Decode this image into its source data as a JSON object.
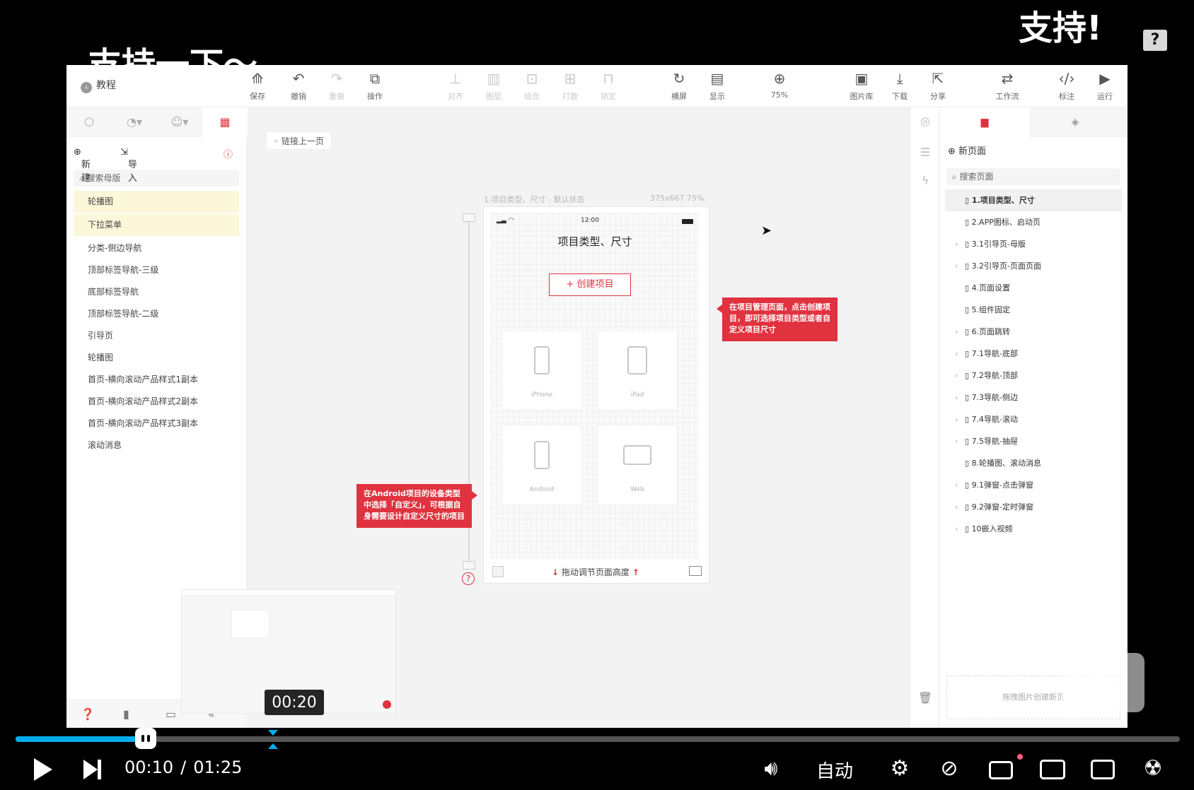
{
  "danmaku": {
    "left": "支持一下～",
    "right": "支持!"
  },
  "help_badge": "?",
  "app": {
    "tutorial_label": "教程",
    "toolbar": [
      {
        "icon": "⟰",
        "label": "保存",
        "dim": false
      },
      {
        "icon": "↶",
        "label": "撤销",
        "dim": false
      },
      {
        "icon": "↷",
        "label": "重做",
        "dim": true
      },
      {
        "icon": "⧉",
        "label": "操作",
        "dim": false
      },
      {
        "icon": "⊥",
        "label": "对齐",
        "dim": true
      },
      {
        "icon": "▥",
        "label": "图层",
        "dim": true
      },
      {
        "icon": "⊡",
        "label": "组合",
        "dim": true
      },
      {
        "icon": "⊞",
        "label": "打散",
        "dim": true
      },
      {
        "icon": "⊓",
        "label": "锁定",
        "dim": true
      },
      {
        "icon": "↻",
        "label": "横屏",
        "dim": false
      },
      {
        "icon": "▤",
        "label": "显示",
        "dim": false
      },
      {
        "icon": "⊕",
        "label": "75%",
        "dim": false
      },
      {
        "icon": "▣",
        "label": "图片库",
        "dim": false
      },
      {
        "icon": "⤓",
        "label": "下载",
        "dim": false
      },
      {
        "icon": "⇱",
        "label": "分享",
        "dim": false
      },
      {
        "icon": "⇄",
        "label": "工作流",
        "dim": false
      },
      {
        "icon": "‹/›",
        "label": "标注",
        "dim": false
      },
      {
        "icon": "▶",
        "label": "运行",
        "dim": false
      }
    ],
    "left_panel": {
      "new_label": "新建",
      "import_label": "导入",
      "search_placeholder": "搜索母版",
      "items": [
        {
          "label": "轮播图",
          "hl": true
        },
        {
          "label": "下拉菜单",
          "hl": true
        },
        {
          "label": "分类-侧边导航",
          "hl": false
        },
        {
          "label": "顶部标签导航-三级",
          "hl": false
        },
        {
          "label": "底部标签导航",
          "hl": false
        },
        {
          "label": "顶部标签导航-二级",
          "hl": false
        },
        {
          "label": "引导页",
          "hl": false
        },
        {
          "label": "轮播图",
          "hl": false
        },
        {
          "label": "首页-横向滚动产品样式1副本",
          "hl": false
        },
        {
          "label": "首页-横向滚动产品样式2副本",
          "hl": false
        },
        {
          "label": "首页-横向滚动产品样式3副本",
          "hl": false
        },
        {
          "label": "滚动消息",
          "hl": false
        }
      ]
    },
    "canvas": {
      "link_prev": "链接上一页",
      "artboard_label": "1.项目类型、尺寸 - 默认状态",
      "artboard_size": "375x667 75%",
      "phone": {
        "time": "12:00",
        "title": "项目类型、尺寸",
        "create_button": "+ 创建项目",
        "devices": [
          "iPhone",
          "iPad",
          "Android",
          "Web"
        ],
        "resize_hint": "拖动调节页面高度"
      },
      "callout_right": "在项目管理页面，点击创建项目，即可选择项目类型或者自定义项目尺寸",
      "callout_left": "在Android项目的设备类型中选择「自定义」，可根据自身需要设计自定义尺寸的项目"
    },
    "right_panel": {
      "new_page": "新页面",
      "search_placeholder": "搜索页面",
      "drop_hint": "拖拽图片创建新页",
      "pages": [
        {
          "label": "1.项目类型、尺寸",
          "active": true,
          "expand": false
        },
        {
          "label": "2.APP图标、启动页",
          "active": false,
          "expand": false
        },
        {
          "label": "3.1引导页-母版",
          "active": false,
          "expand": true
        },
        {
          "label": "3.2引导页-页面页面",
          "active": false,
          "expand": true
        },
        {
          "label": "4.页面设置",
          "active": false,
          "expand": false
        },
        {
          "label": "5.组件固定",
          "active": false,
          "expand": false
        },
        {
          "label": "6.页面跳转",
          "active": false,
          "expand": true
        },
        {
          "label": "7.1导航-底部",
          "active": false,
          "expand": true
        },
        {
          "label": "7.2导航-顶部",
          "active": false,
          "expand": true
        },
        {
          "label": "7.3导航-侧边",
          "active": false,
          "expand": true
        },
        {
          "label": "7.4导航-滚动",
          "active": false,
          "expand": true
        },
        {
          "label": "7.5导航-抽屉",
          "active": false,
          "expand": true
        },
        {
          "label": "8.轮播图、滚动消息",
          "active": false,
          "expand": false
        },
        {
          "label": "9.1弹窗-点击弹窗",
          "active": false,
          "expand": true
        },
        {
          "label": "9.2弹窗-定时弹窗",
          "active": false,
          "expand": true
        },
        {
          "label": "10嵌入视频",
          "active": false,
          "expand": true
        }
      ]
    }
  },
  "player": {
    "preview_time": "00:20",
    "current_time": "00:10",
    "separator": "/",
    "total_time": "01:25",
    "played_fraction": 0.112,
    "buffered_fraction": 0.118,
    "hover_fraction": 0.221,
    "quality_label": "自动",
    "accent_color": "#00aeec"
  }
}
